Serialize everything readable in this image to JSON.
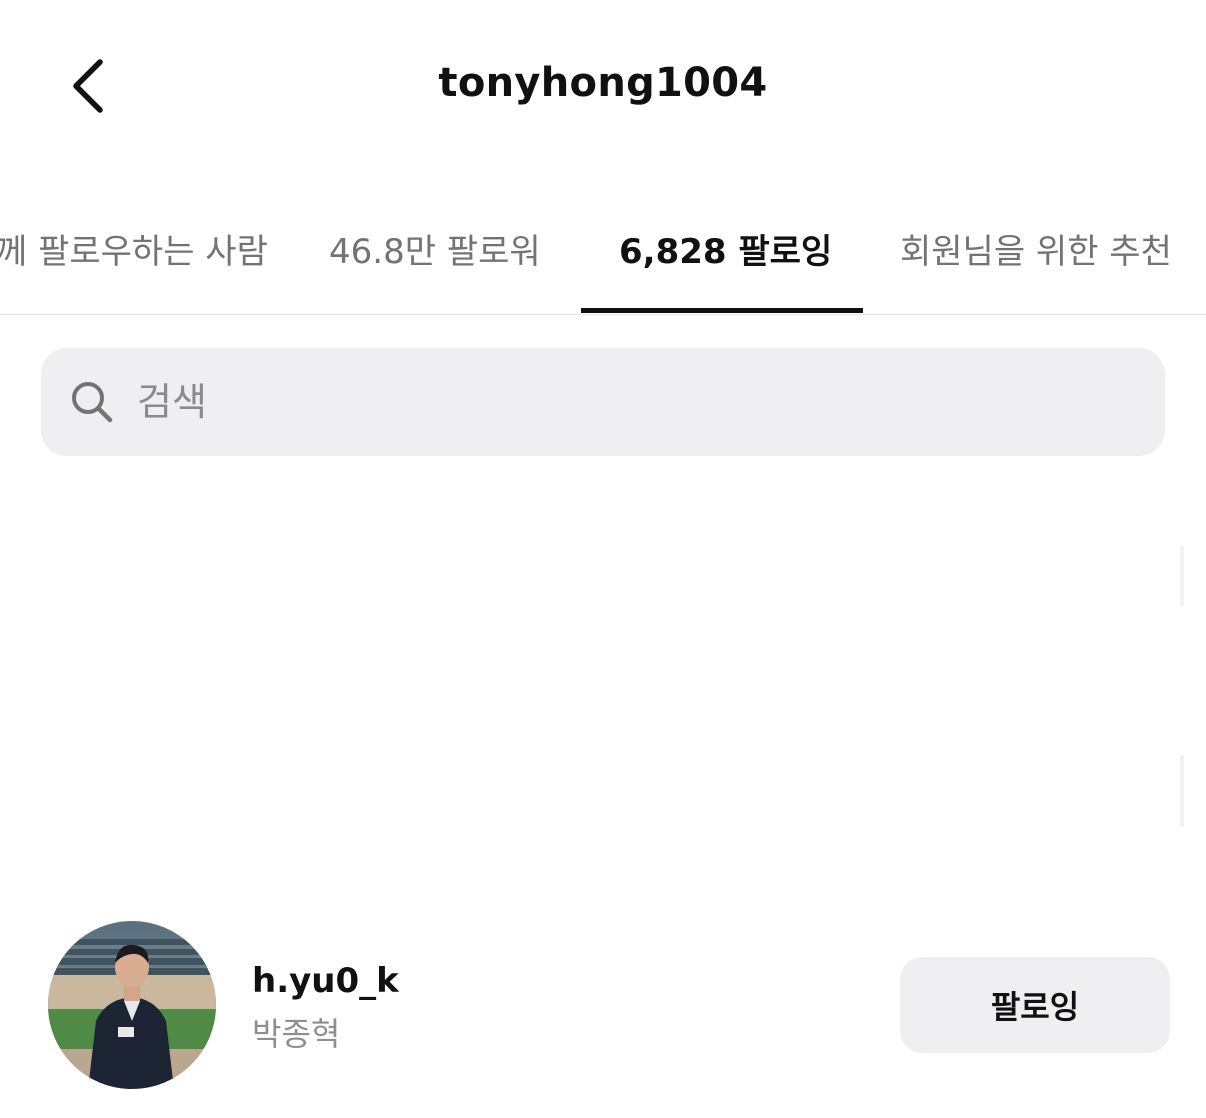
{
  "header": {
    "title": "tonyhong1004",
    "back_icon": "chevron-left-icon"
  },
  "tabs": [
    {
      "label": "함께 팔로우하는 사람",
      "visible_label": "께 팔로우하는 사람",
      "active": false
    },
    {
      "label": "46.8만 팔로워",
      "active": false
    },
    {
      "label": "6,828 팔로잉",
      "active": true
    },
    {
      "label": "회원님을 위한 추천",
      "active": false
    }
  ],
  "search": {
    "placeholder": "검색",
    "value": "",
    "icon": "search-icon"
  },
  "list": [
    {
      "username": "h.yu0_k",
      "full_name": "박종혁",
      "button_label": "팔로잉",
      "avatar": "profile-photo"
    }
  ],
  "colors": {
    "text_primary": "#111111",
    "text_secondary": "#737373",
    "search_bg": "#efeff2",
    "button_bg": "#efeff2",
    "divider": "#e6e6e6"
  }
}
